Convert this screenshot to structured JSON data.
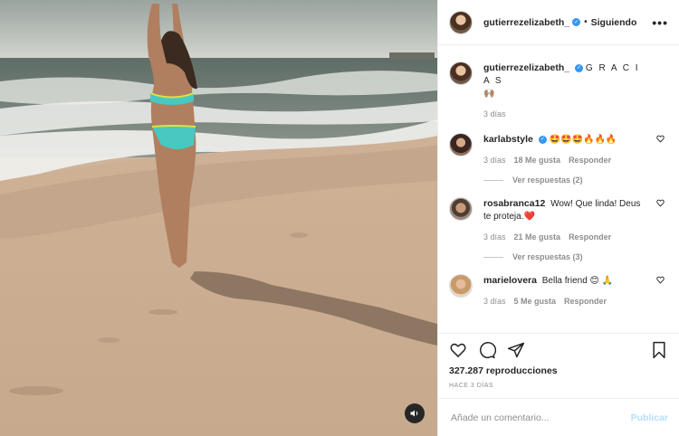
{
  "post": {
    "author": "gutierrezelizabeth_",
    "follow_label": "Siguiendo",
    "more_label": "•••",
    "caption": "G R A C I A S",
    "caption_emoji": "🙌🏽",
    "caption_age": "3 días"
  },
  "comments": [
    {
      "user": "karlabstyle",
      "text": "🤩🤩🤩🔥🔥🔥",
      "age": "3 días",
      "likes": "18 Me gusta",
      "reply_label": "Responder",
      "view_replies": "Ver respuestas (2)"
    },
    {
      "user": "rosabranca12",
      "text": "Wow! Que linda! Deus te proteja.❤️",
      "age": "3 días",
      "likes": "21 Me gusta",
      "reply_label": "Responder",
      "view_replies": "Ver respuestas (3)"
    },
    {
      "user": "marielovera",
      "text": "Bella friend 😊 🙏",
      "age": "3 días",
      "likes": "5 Me gusta",
      "reply_label": "Responder"
    }
  ],
  "footer": {
    "views": "327.287 reproducciones",
    "age": "HACE 3 DÍAS",
    "comment_placeholder": "Añade un comentario...",
    "post_label": "Publicar"
  },
  "colors": {
    "verified": "#3897f0",
    "publish_disabled": "#b2dffc",
    "muted": "#8e8e8e"
  }
}
